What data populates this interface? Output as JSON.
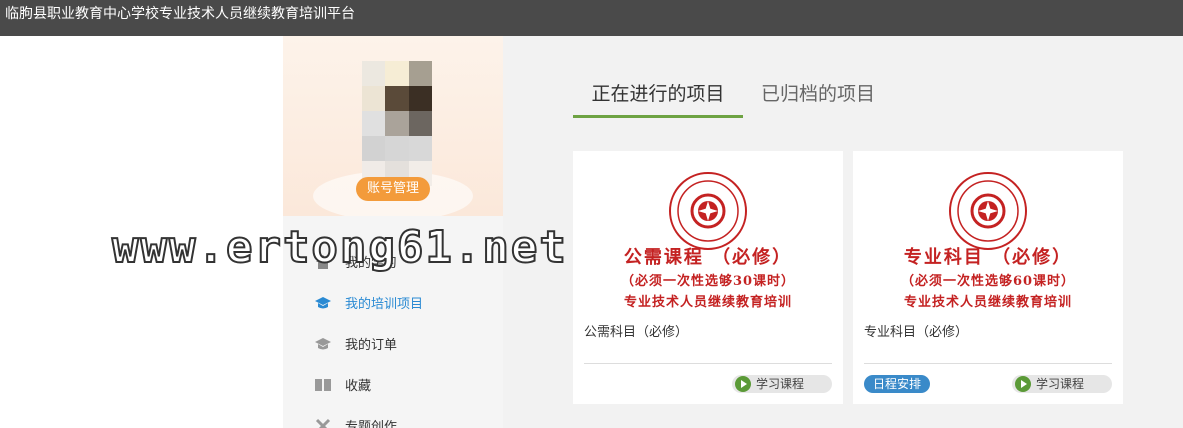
{
  "header": {
    "title": "临朐县职业教育中心学校专业技术人员继续教育培训平台"
  },
  "profile": {
    "account_button": "账号管理",
    "avatar_colors": [
      "#ece8e0",
      "#f6edd5",
      "#a69f91",
      "#ece4d4",
      "#5a4a39",
      "#3b2f24",
      "#e0e0e0",
      "#aaa39a",
      "#6c6660",
      "#d2d2d2",
      "#d6d6d6",
      "#d8d8d8",
      "#f0ebe7",
      "#e4e0dc",
      "#f2ede8"
    ]
  },
  "sidebar": {
    "items": [
      {
        "label": "我的学习",
        "icon": "home-icon"
      },
      {
        "label": "我的培训项目",
        "icon": "graduation-cap-icon"
      },
      {
        "label": "我的订单",
        "icon": "order-icon"
      },
      {
        "label": "收藏",
        "icon": "book-icon"
      },
      {
        "label": "专题创作",
        "icon": "tools-icon"
      }
    ]
  },
  "tabs": {
    "active": "正在进行的项目",
    "archived": "已归档的项目"
  },
  "cards": [
    {
      "cover_title": "公需课程 （必修）",
      "cover_sub": "（必须一次性选够30课时）",
      "cover_sub2": "专业技术人员继续教育培训",
      "name": "公需科目（必修）",
      "study_button": "学习课程"
    },
    {
      "cover_title": "专业科目 （必修）",
      "cover_sub": "（必须一次性选够60课时）",
      "cover_sub2": "专业技术人员继续教育培训",
      "name": "专业科目（必修）",
      "schedule_badge": "日程安排",
      "study_button": "学习课程"
    }
  ],
  "watermark": "www.ertong61.net",
  "colors": {
    "accent_green": "#6ea343",
    "active_blue": "#2a8ad3",
    "seal_red": "#c42222",
    "orange": "#f39b3b"
  }
}
